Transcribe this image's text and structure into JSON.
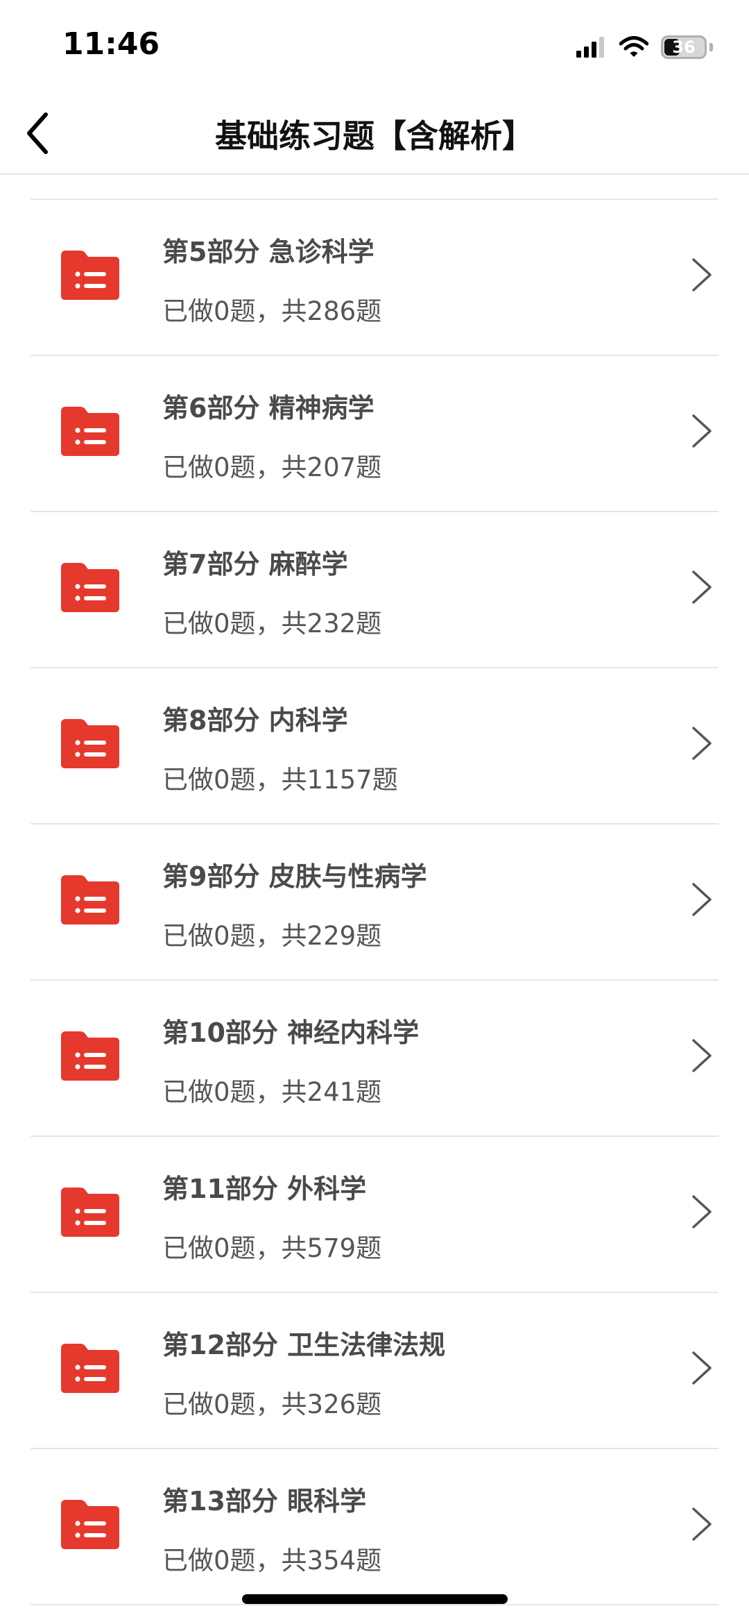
{
  "status_bar": {
    "time": "11:46",
    "battery": "36",
    "icons": [
      "cellular-signal-icon",
      "wifi-icon",
      "battery-icon"
    ]
  },
  "nav": {
    "title": "基础练习题【含解析】",
    "back_icon": "chevron-left-icon"
  },
  "colors": {
    "folder_icon": "#e5392d",
    "divider": "#e6e6e6",
    "title_text": "#4a4a4a"
  },
  "items": [
    {
      "title": "第5部分 急诊科学",
      "subtitle": "已做0题，共286题"
    },
    {
      "title": "第6部分 精神病学",
      "subtitle": "已做0题，共207题"
    },
    {
      "title": "第7部分 麻醉学",
      "subtitle": "已做0题，共232题"
    },
    {
      "title": "第8部分 内科学",
      "subtitle": "已做0题，共1157题"
    },
    {
      "title": "第9部分 皮肤与性病学",
      "subtitle": "已做0题，共229题"
    },
    {
      "title": "第10部分 神经内科学",
      "subtitle": "已做0题，共241题"
    },
    {
      "title": "第11部分 外科学",
      "subtitle": "已做0题，共579题"
    },
    {
      "title": "第12部分 卫生法律法规",
      "subtitle": "已做0题，共326题"
    },
    {
      "title": "第13部分 眼科学",
      "subtitle": "已做0题，共354题"
    }
  ]
}
